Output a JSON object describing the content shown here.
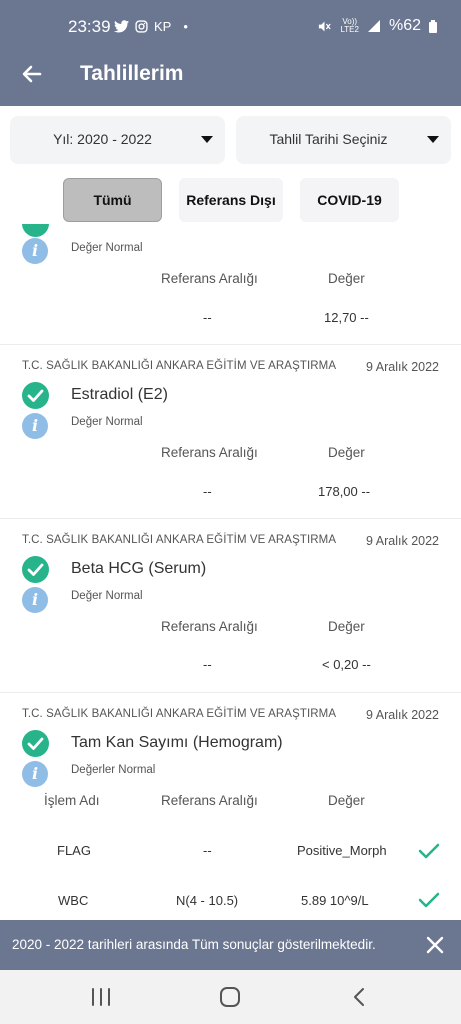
{
  "status_bar": {
    "time": "23:39",
    "carrier": "KP",
    "dot": "•",
    "lte_top": "Vo))",
    "lte_bottom": "LTE2",
    "battery": "%62"
  },
  "app_bar": {
    "title": "Tahlillerim",
    "back_icon": "arrow-left-icon"
  },
  "filters": {
    "year_dropdown": "Yıl: 2020 - 2022",
    "date_dropdown": "Tahlil Tarihi Seçiniz"
  },
  "tabs": [
    {
      "label": "Tümü",
      "active": true
    },
    {
      "label": "Referans Dışı",
      "active": false
    },
    {
      "label": "COVID-19",
      "active": false
    }
  ],
  "results": [
    {
      "status": "Değer Normal",
      "ref_header": "Referans Aralığı",
      "val_header": "Değer",
      "ref": "--",
      "value": "12,70 --"
    },
    {
      "institution": "T.C. SAĞLIK BAKANLIĞI ANKARA EĞİTİM VE ARAŞTIRMA",
      "date": "9 Aralık 2022",
      "name": "Estradiol (E2)",
      "status": "Değer Normal",
      "ref_header": "Referans Aralığı",
      "val_header": "Değer",
      "ref": "--",
      "value": "178,00 --"
    },
    {
      "institution": "T.C. SAĞLIK BAKANLIĞI ANKARA EĞİTİM VE ARAŞTIRMA",
      "date": "9 Aralık 2022",
      "name": "Beta HCG (Serum)",
      "status": "Değer Normal",
      "ref_header": "Referans Aralığı",
      "val_header": "Değer",
      "ref": "--",
      "value": "< 0,20 --"
    },
    {
      "institution": "T.C. SAĞLIK BAKANLIĞI ANKARA EĞİTİM VE ARAŞTIRMA",
      "date": "9 Aralık 2022",
      "name": "Tam Kan Sayımı (Hemogram)",
      "status": "Değerler Normal",
      "op_header": "İşlem Adı",
      "ref_header": "Referans Aralığı",
      "val_header": "Değer",
      "rows": [
        {
          "name": "FLAG",
          "ref": "--",
          "value": "Positive_Morph"
        },
        {
          "name": "WBC",
          "ref": "N(4 - 10.5)",
          "value": "5.89 10^9/L"
        }
      ]
    }
  ],
  "snackbar": {
    "message": "2020 - 2022 tarihleri arasında Tüm sonuçlar gösterilmektedir."
  },
  "colors": {
    "header": "#6b7691",
    "check": "#27b48a",
    "info": "#8fbde6"
  }
}
